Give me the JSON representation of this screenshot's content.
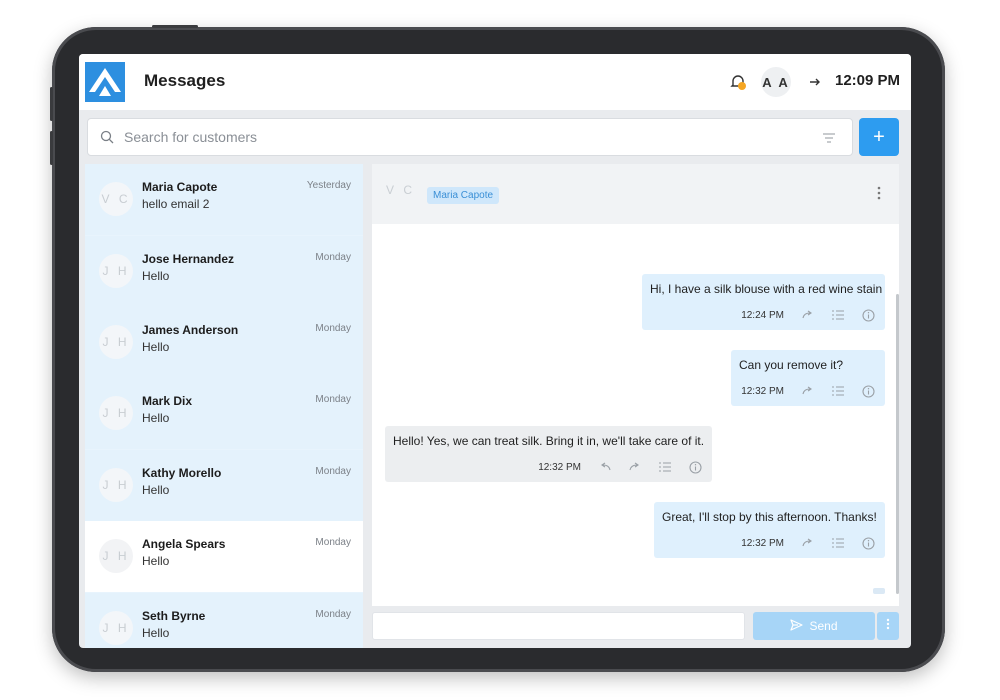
{
  "header": {
    "title": "Messages",
    "user_initials": "A A",
    "time": "12:09 PM"
  },
  "search": {
    "placeholder": "Search for customers",
    "add_label": "+"
  },
  "conversations": [
    {
      "initials": "V C",
      "name": "Maria Capote",
      "preview": "hello email 2",
      "date": "Yesterday"
    },
    {
      "initials": "J H",
      "name": "Jose Hernandez",
      "preview": "Hello",
      "date": "Monday"
    },
    {
      "initials": "J H",
      "name": "James Anderson",
      "preview": "Hello",
      "date": "Monday"
    },
    {
      "initials": "J H",
      "name": "Mark Dix",
      "preview": "Hello",
      "date": "Monday"
    },
    {
      "initials": "J H",
      "name": "Kathy Morello",
      "preview": "Hello",
      "date": "Monday"
    },
    {
      "initials": "J H",
      "name": "Angela Spears",
      "preview": "Hello",
      "date": "Monday"
    },
    {
      "initials": "J H",
      "name": "Seth Byrne",
      "preview": "Hello",
      "date": "Monday"
    }
  ],
  "chat": {
    "header_initials": "V C",
    "contact_tag": "Maria Capote",
    "messages": [
      {
        "direction": "out",
        "text": "Hi, I have a silk blouse with a red wine stain",
        "time": "12:24 PM"
      },
      {
        "direction": "out",
        "text": "Can you remove it?",
        "time": "12:32 PM"
      },
      {
        "direction": "in",
        "text": "Hello! Yes, we can treat silk. Bring it in, we'll take care of it.",
        "time": "12:32 PM"
      },
      {
        "direction": "out",
        "text": "Great, I'll stop by this afternoon. Thanks!",
        "time": "12:32 PM"
      }
    ]
  },
  "composer": {
    "value": "",
    "send_label": "Send"
  },
  "icons": {
    "logo": "logo-icon",
    "bell": "bell-icon",
    "logout": "arrow-right-icon",
    "search": "search-icon",
    "filter": "filter-icon",
    "kebab": "kebab-icon",
    "reply": "reply-icon",
    "forward": "forward-icon",
    "list": "list-icon",
    "info": "info-icon",
    "send": "send-icon"
  },
  "colors": {
    "accent": "#2d9cf0",
    "selected_row": "#e4f2fc",
    "outgoing_bubble": "#dff0fd",
    "incoming_bubble": "#eceef0",
    "notification_dot": "#f5a623"
  }
}
